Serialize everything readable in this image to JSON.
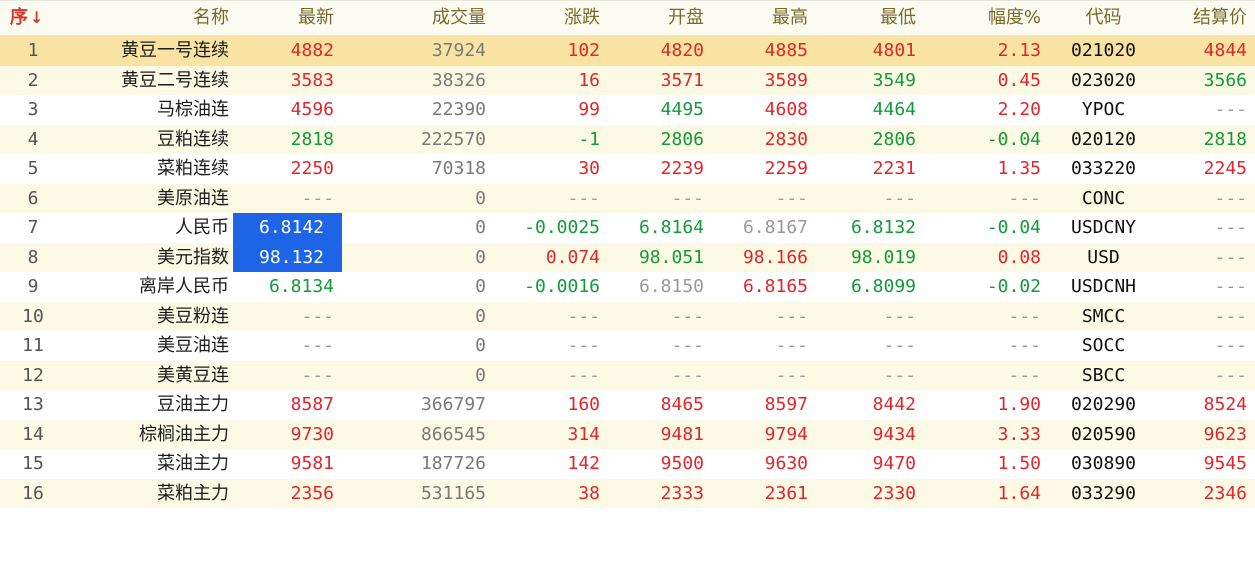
{
  "headers": {
    "seq": "序",
    "name": "名称",
    "last": "最新",
    "volume": "成交量",
    "change": "涨跌",
    "open": "开盘",
    "high": "最高",
    "low": "最低",
    "amplitude": "幅度%",
    "code": "代码",
    "settle": "结算价"
  },
  "sort_indicator": "↓",
  "selected_row": 1,
  "highlighted_cells": [
    7,
    8
  ],
  "colors": {
    "up": "#e0262b",
    "down": "#139a3a",
    "flat": "#9a9a9a",
    "selection": "#f8e3a3",
    "highlight": "#1d64e6"
  },
  "rows": [
    {
      "seq": "1",
      "name": "黄豆一号连续",
      "last": "4882",
      "volume": "37924",
      "change": "102",
      "open": "4820",
      "high": "4885",
      "low": "4801",
      "amplitude": "2.13",
      "code": "021020",
      "settle": "4844"
    },
    {
      "seq": "2",
      "name": "黄豆二号连续",
      "last": "3583",
      "volume": "38326",
      "change": "16",
      "open": "3571",
      "high": "3589",
      "low": "3549",
      "amplitude": "0.45",
      "code": "023020",
      "settle": "3566"
    },
    {
      "seq": "3",
      "name": "马棕油连",
      "last": "4596",
      "volume": "22390",
      "change": "99",
      "open": "4495",
      "high": "4608",
      "low": "4464",
      "amplitude": "2.20",
      "code": "YPOC",
      "settle": "---"
    },
    {
      "seq": "4",
      "name": "豆粕连续",
      "last": "2818",
      "volume": "222570",
      "change": "-1",
      "open": "2806",
      "high": "2830",
      "low": "2806",
      "amplitude": "-0.04",
      "code": "020120",
      "settle": "2818"
    },
    {
      "seq": "5",
      "name": "菜粕连续",
      "last": "2250",
      "volume": "70318",
      "change": "30",
      "open": "2239",
      "high": "2259",
      "low": "2231",
      "amplitude": "1.35",
      "code": "033220",
      "settle": "2245"
    },
    {
      "seq": "6",
      "name": "美原油连",
      "last": "---",
      "volume": "0",
      "change": "---",
      "open": "---",
      "high": "---",
      "low": "---",
      "amplitude": "---",
      "code": "CONC",
      "settle": "---"
    },
    {
      "seq": "7",
      "name": "人民币",
      "last": "6.8142",
      "volume": "0",
      "change": "-0.0025",
      "open": "6.8164",
      "high": "6.8167",
      "low": "6.8132",
      "amplitude": "-0.04",
      "code": "USDCNY",
      "settle": "---"
    },
    {
      "seq": "8",
      "name": "美元指数",
      "last": "98.132",
      "volume": "0",
      "change": "0.074",
      "open": "98.051",
      "high": "98.166",
      "low": "98.019",
      "amplitude": "0.08",
      "code": "USD",
      "settle": "---"
    },
    {
      "seq": "9",
      "name": "离岸人民币",
      "last": "6.8134",
      "volume": "0",
      "change": "-0.0016",
      "open": "6.8150",
      "high": "6.8165",
      "low": "6.8099",
      "amplitude": "-0.02",
      "code": "USDCNH",
      "settle": "---"
    },
    {
      "seq": "10",
      "name": "美豆粉连",
      "last": "---",
      "volume": "0",
      "change": "---",
      "open": "---",
      "high": "---",
      "low": "---",
      "amplitude": "---",
      "code": "SMCC",
      "settle": "---"
    },
    {
      "seq": "11",
      "name": "美豆油连",
      "last": "---",
      "volume": "0",
      "change": "---",
      "open": "---",
      "high": "---",
      "low": "---",
      "amplitude": "---",
      "code": "SOCC",
      "settle": "---"
    },
    {
      "seq": "12",
      "name": "美黄豆连",
      "last": "---",
      "volume": "0",
      "change": "---",
      "open": "---",
      "high": "---",
      "low": "---",
      "amplitude": "---",
      "code": "SBCC",
      "settle": "---"
    },
    {
      "seq": "13",
      "name": "豆油主力",
      "last": "8587",
      "volume": "366797",
      "change": "160",
      "open": "8465",
      "high": "8597",
      "low": "8442",
      "amplitude": "1.90",
      "code": "020290",
      "settle": "8524"
    },
    {
      "seq": "14",
      "name": "棕榈油主力",
      "last": "9730",
      "volume": "866545",
      "change": "314",
      "open": "9481",
      "high": "9794",
      "low": "9434",
      "amplitude": "3.33",
      "code": "020590",
      "settle": "9623"
    },
    {
      "seq": "15",
      "name": "菜油主力",
      "last": "9581",
      "volume": "187726",
      "change": "142",
      "open": "9500",
      "high": "9630",
      "low": "9470",
      "amplitude": "1.50",
      "code": "030890",
      "settle": "9545"
    },
    {
      "seq": "16",
      "name": "菜粕主力",
      "last": "2356",
      "volume": "531165",
      "change": "38",
      "open": "2333",
      "high": "2361",
      "low": "2330",
      "amplitude": "1.64",
      "code": "033290",
      "settle": "2346"
    }
  ]
}
